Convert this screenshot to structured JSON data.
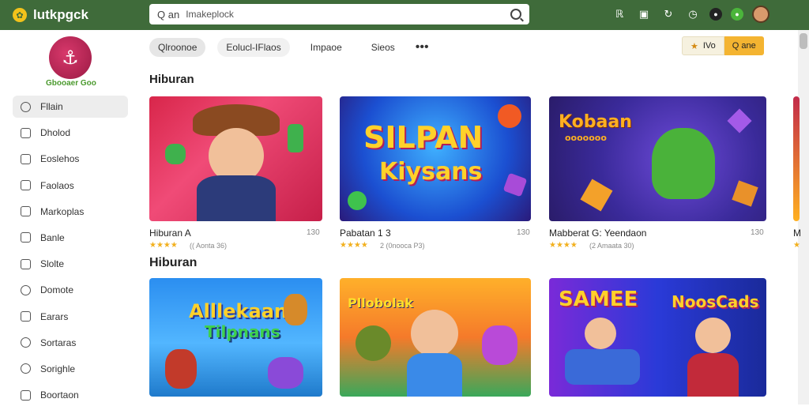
{
  "topbar": {
    "app_name": "lutkpgck",
    "search_prefix": "Q an",
    "search_value": "Imakeplock",
    "icons": [
      "r-icon",
      "box-icon",
      "refresh-icon",
      "clock-icon",
      "dark-badge-icon",
      "green-badge-icon"
    ]
  },
  "sidebar": {
    "brand_label": "Gbooaer Goo",
    "items": [
      {
        "label": "Fllain",
        "icon": "search-icon"
      },
      {
        "label": "Dholod",
        "icon": "shield-icon"
      },
      {
        "label": "Eoslehos",
        "icon": "edit-icon"
      },
      {
        "label": "Faolaos",
        "icon": "doc-icon"
      },
      {
        "label": "Markoplas",
        "icon": "tag-icon"
      },
      {
        "label": "Banle",
        "icon": "chart-icon"
      },
      {
        "label": "Slolte",
        "icon": "square-icon"
      },
      {
        "label": "Domote",
        "icon": "circle-icon"
      },
      {
        "label": "Earars",
        "icon": "check-icon"
      },
      {
        "label": "Sortaras",
        "icon": "list-icon"
      },
      {
        "label": "Sorighle",
        "icon": "gear-icon"
      },
      {
        "label": "Boortaon",
        "icon": "box-icon"
      }
    ]
  },
  "chips": [
    "Qlroonoe",
    "Eolucl-IFlaos",
    "Impaoe",
    "Sieos"
  ],
  "actions": {
    "a1": "IVo",
    "a2": "Q ane"
  },
  "sections": [
    {
      "title": "Hiburan"
    },
    {
      "title": "Hiburan"
    }
  ],
  "cards_row1": [
    {
      "title": "Hiburan A",
      "meta": "130",
      "rating": "(( Aonta 36)",
      "stars": "★★★★"
    },
    {
      "title": "Pabatan 1 3",
      "meta": "130",
      "rating": "2 (0nooca P3)",
      "stars": "★★★★"
    },
    {
      "title": "Mabberat G: Yeendaon",
      "meta": "130",
      "rating": "(2 Amaata 30)",
      "stars": "★★★★"
    },
    {
      "title": "M",
      "meta": "",
      "rating": "",
      "stars": "★"
    }
  ],
  "cards_row2": [
    {
      "art_text_1": "Alllekaan",
      "art_text_2": "Tilpnans"
    },
    {
      "art_text_1": "Pllobolak",
      "art_text_2": ""
    },
    {
      "art_text_1": "SAMEE",
      "art_text_2": "NoosCads"
    }
  ],
  "art_row1": [
    {
      "art_text_1": "",
      "art_text_2": ""
    },
    {
      "art_text_1": "SILPAN",
      "art_text_2": "Kiysans"
    },
    {
      "art_text_1": "Kobaan",
      "art_text_2": "ooooooo"
    }
  ],
  "colors": {
    "topbar": "#3f6b3a",
    "accent": "#f4b431",
    "stars": "#f2b01e"
  }
}
